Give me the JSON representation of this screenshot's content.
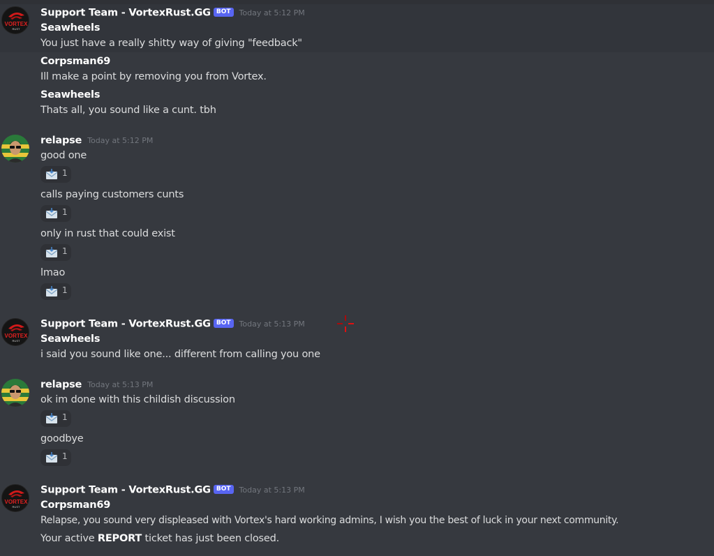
{
  "colors": {
    "background": "#36393f",
    "bot_badge": "#5865f2",
    "username": "#ffffff",
    "timestamp": "#72767d",
    "reaction_bg": "#2f3136"
  },
  "groups": [
    {
      "author": "Support Team - VortexRust.GG",
      "badge": "BOT",
      "timestamp": "Today at 5:12 PM",
      "avatar": {
        "icon": "vortex-logo",
        "text": "VORTEX",
        "subtext": "RUST"
      },
      "lines": [
        {
          "type": "name",
          "text": "Seawheels"
        },
        {
          "type": "text",
          "text": "You just have a really shitty way of giving \"feedback\""
        },
        {
          "type": "name",
          "text": "Corpsman69"
        },
        {
          "type": "text",
          "text": "Ill make a point by removing you from Vortex."
        },
        {
          "type": "name",
          "text": "Seawheels"
        },
        {
          "type": "text",
          "text": "Thats all, you sound like a cunt. tbh"
        }
      ]
    },
    {
      "author": "relapse",
      "timestamp": "Today at 5:12 PM",
      "avatar": {
        "icon": "user-avatar"
      },
      "messages": [
        {
          "text": "good one",
          "reaction": {
            "icon": "envelope-icon",
            "count": "1"
          }
        },
        {
          "text": "calls paying customers cunts",
          "reaction": {
            "icon": "envelope-icon",
            "count": "1"
          }
        },
        {
          "text": "only in rust that could exist",
          "reaction": {
            "icon": "envelope-icon",
            "count": "1"
          }
        },
        {
          "text": "lmao",
          "reaction": {
            "icon": "envelope-icon",
            "count": "1"
          }
        }
      ]
    },
    {
      "author": "Support Team - VortexRust.GG",
      "badge": "BOT",
      "timestamp": "Today at 5:13 PM",
      "avatar": {
        "icon": "vortex-logo",
        "text": "VORTEX",
        "subtext": "RUST"
      },
      "lines": [
        {
          "type": "name",
          "text": "Seawheels"
        },
        {
          "type": "text",
          "text": "i said you sound like one... different from calling you one"
        }
      ]
    },
    {
      "author": "relapse",
      "timestamp": "Today at 5:13 PM",
      "avatar": {
        "icon": "user-avatar"
      },
      "messages": [
        {
          "text": "ok im done with this childish discussion",
          "reaction": {
            "icon": "envelope-icon",
            "count": "1"
          }
        },
        {
          "text": "goodbye",
          "reaction": {
            "icon": "envelope-icon",
            "count": "1"
          }
        }
      ]
    },
    {
      "author": "Support Team - VortexRust.GG",
      "badge": "BOT",
      "timestamp": "Today at 5:13 PM",
      "avatar": {
        "icon": "vortex-logo",
        "text": "VORTEX",
        "subtext": "RUST"
      },
      "lines": [
        {
          "type": "name",
          "text": "Corpsman69"
        },
        {
          "type": "text",
          "text": "Relapse, you sound very displeased with Vortex's hard working admins, I wish you the best of luck in your next community."
        },
        {
          "type": "text",
          "before": "Your active ",
          "bold": "REPORT",
          "after": " ticket has just been closed."
        }
      ]
    }
  ]
}
